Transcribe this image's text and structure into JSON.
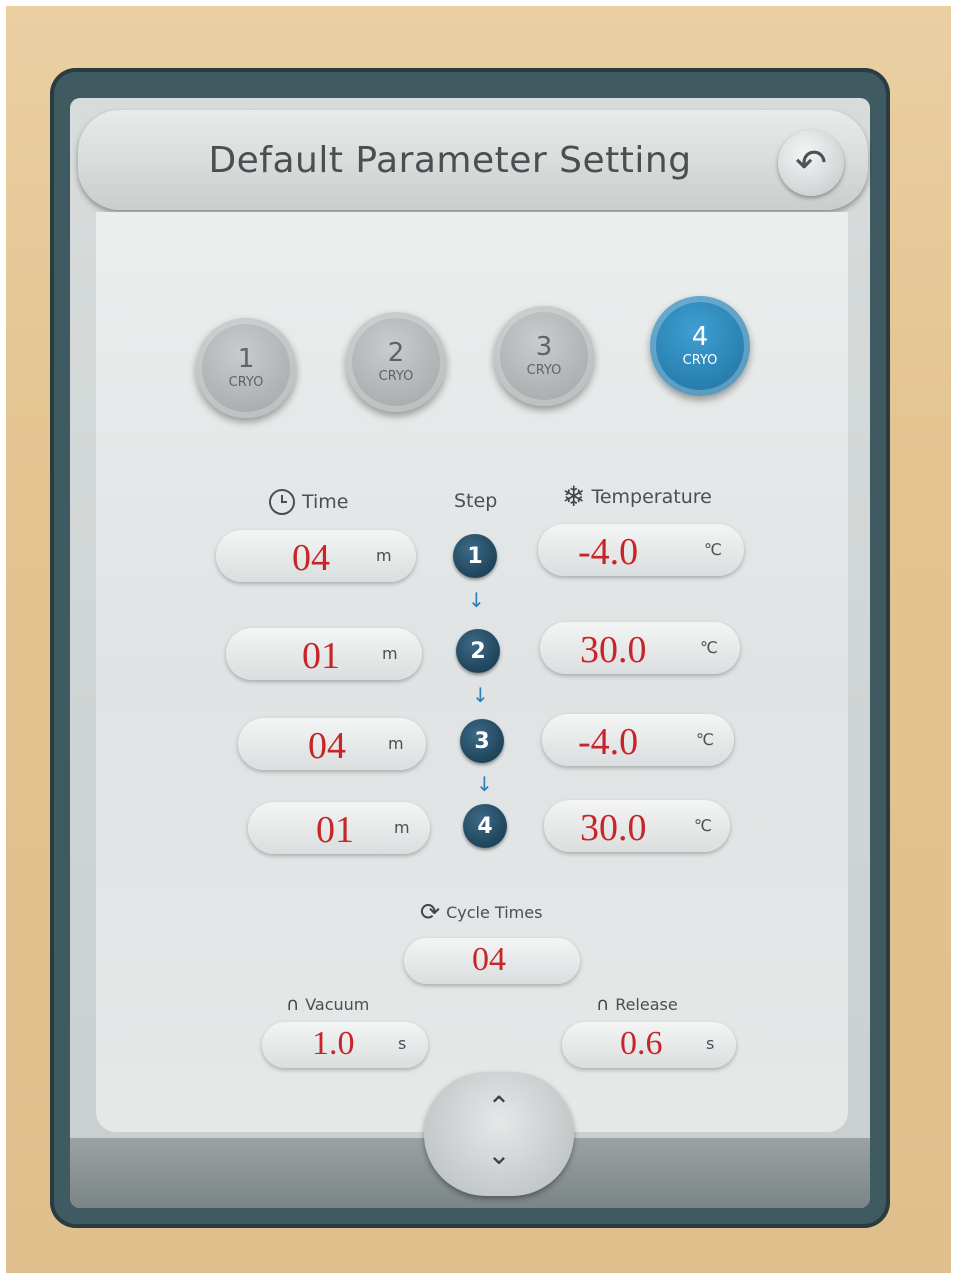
{
  "header": {
    "title": "Default Parameter Setting"
  },
  "cryo_tabs": [
    {
      "number": "1",
      "label": "CRYO",
      "active": false
    },
    {
      "number": "2",
      "label": "CRYO",
      "active": false
    },
    {
      "number": "3",
      "label": "CRYO",
      "active": false
    },
    {
      "number": "4",
      "label": "CRYO",
      "active": true
    }
  ],
  "columns": {
    "time": "Time",
    "step": "Step",
    "temperature": "Temperature"
  },
  "steps": [
    {
      "time": "04",
      "time_unit": "m",
      "step": "1",
      "temp": "-4.0",
      "temp_unit": "℃"
    },
    {
      "time": "01",
      "time_unit": "m",
      "step": "2",
      "temp": "30.0",
      "temp_unit": "℃"
    },
    {
      "time": "04",
      "time_unit": "m",
      "step": "3",
      "temp": "-4.0",
      "temp_unit": "℃"
    },
    {
      "time": "01",
      "time_unit": "m",
      "step": "4",
      "temp": "30.0",
      "temp_unit": "℃"
    }
  ],
  "cycle": {
    "label": "Cycle Times",
    "value": "04"
  },
  "vacuum": {
    "label": "Vacuum",
    "value": "1.0",
    "unit": "s"
  },
  "release": {
    "label": "Release",
    "value": "0.6",
    "unit": "s"
  },
  "colors": {
    "accent": "#1c6e9c",
    "value_red": "#c8252b",
    "step_dark": "#13344a"
  },
  "icons": [
    "back-icon",
    "clock-icon",
    "snowflake-icon",
    "cycle-icon",
    "vacuum-icon",
    "release-icon",
    "chevron-up-icon",
    "chevron-down-icon"
  ]
}
